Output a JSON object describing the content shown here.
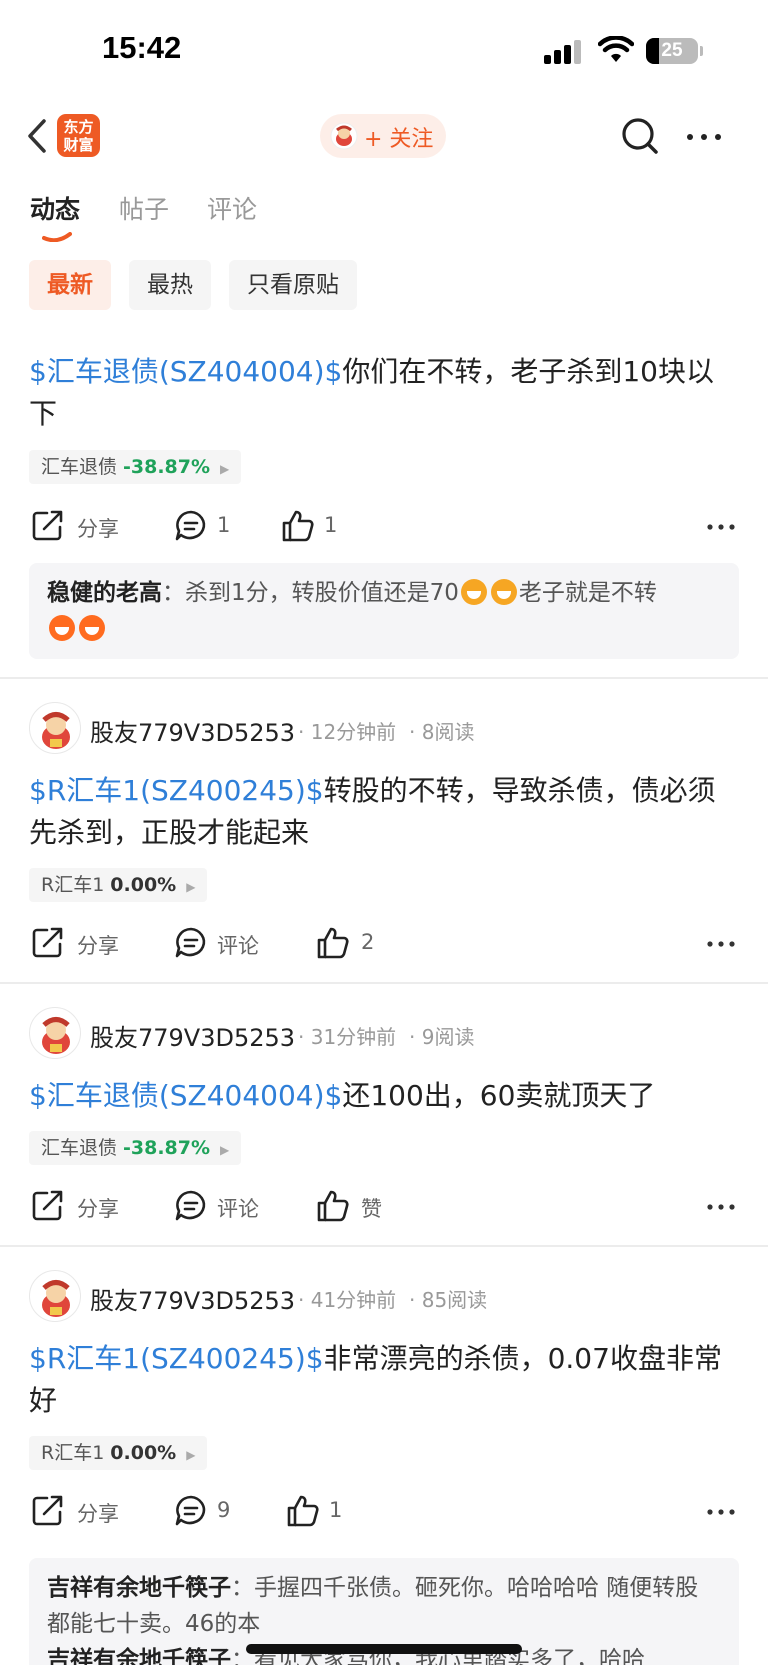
{
  "status_bar": {
    "time": "15:42",
    "battery": "25"
  },
  "nav": {
    "logo": "东方\n财富",
    "follow_label": "+ 关注"
  },
  "tabs": [
    "动态",
    "帖子",
    "评论"
  ],
  "filters": [
    "最新",
    "最热",
    "只看原贴"
  ],
  "posts": [
    {
      "stock_link": "$汇车退债(SZ404004)$",
      "text": "你们在不转，老子杀到10块以下",
      "tag": {
        "name": "汇车退债",
        "change": "-38.87%"
      },
      "actions": {
        "share": "分享",
        "comment": "1",
        "like": "1"
      },
      "reply": {
        "name": "稳健的老高",
        "sep": "：",
        "text1": "杀到1分，转股价值还是70",
        "text2": "老子就是不转"
      }
    },
    {
      "author": "股友779V3D5253",
      "time": "12分钟前",
      "reads": "8阅读",
      "stock_link": "$R汇车1(SZ400245)$",
      "text": "转股的不转，导致杀债，债必须先杀到，正股才能起来",
      "tag": {
        "name": "R汇车1",
        "change": "0.00%"
      },
      "actions": {
        "share": "分享",
        "comment": "评论",
        "like": "2"
      }
    },
    {
      "author": "股友779V3D5253",
      "time": "31分钟前",
      "reads": "9阅读",
      "stock_link": "$汇车退债(SZ404004)$",
      "text": "还100出，60卖就顶天了",
      "tag": {
        "name": "汇车退债",
        "change": "-38.87%"
      },
      "actions": {
        "share": "分享",
        "comment": "评论",
        "like": "赞"
      }
    },
    {
      "author": "股友779V3D5253",
      "time": "41分钟前",
      "reads": "85阅读",
      "stock_link": "$R汇车1(SZ400245)$",
      "text": "非常漂亮的杀债，0.07收盘非常好",
      "tag": {
        "name": "R汇车1",
        "change": "0.00%"
      },
      "actions": {
        "share": "分享",
        "comment": "9",
        "like": "1"
      },
      "reply": {
        "name": "吉祥有余地千筷子",
        "sep": "：",
        "text1": "手握四千张债。砸死你。哈哈哈哈 随便转股都能七十卖。46的本"
      },
      "reply2": {
        "name": "吉祥有余地千筷子",
        "sep": "：",
        "text1": "看见大家骂你，我心里踏实多了，哈哈"
      }
    }
  ],
  "icons": [
    "back-icon",
    "logo",
    "search-icon",
    "more-icon",
    "share-icon",
    "comment-icon",
    "like-icon",
    "dots-icon"
  ],
  "colors": {
    "accent": "#ee5a24",
    "link": "#2f7fd8",
    "down": "#1fa25a"
  }
}
